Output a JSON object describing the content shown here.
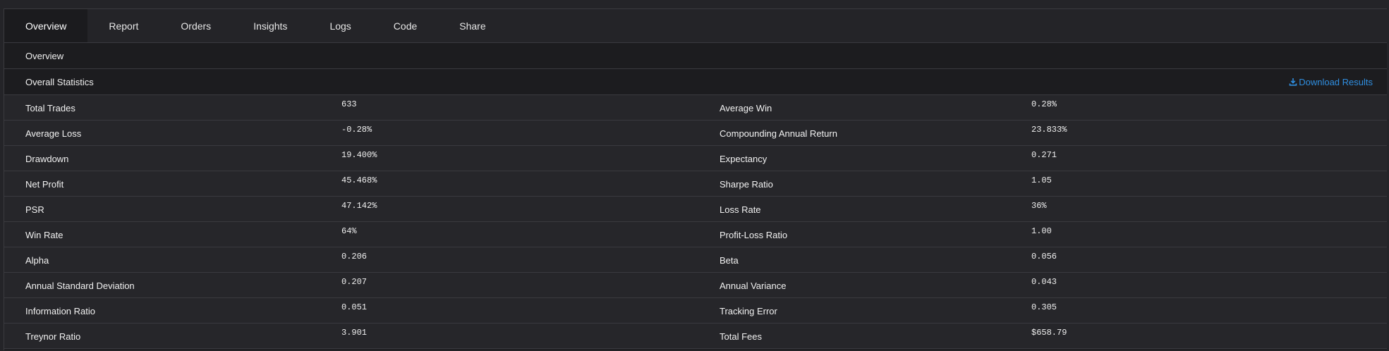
{
  "tabs": [
    {
      "label": "Overview",
      "active": true
    },
    {
      "label": "Report"
    },
    {
      "label": "Orders"
    },
    {
      "label": "Insights"
    },
    {
      "label": "Logs"
    },
    {
      "label": "Code"
    },
    {
      "label": "Share"
    }
  ],
  "overview_bar": {
    "title": "Overview"
  },
  "statistics": {
    "title": "Overall Statistics",
    "download_label": "Download Results",
    "download_icon": "download-icon",
    "accent_color": "#2f8ee0",
    "left": [
      {
        "label": "Total Trades",
        "value": "633"
      },
      {
        "label": "Average Loss",
        "value": "-0.28%"
      },
      {
        "label": "Drawdown",
        "value": "19.400%"
      },
      {
        "label": "Net Profit",
        "value": "45.468%"
      },
      {
        "label": "PSR",
        "value": "47.142%"
      },
      {
        "label": "Win Rate",
        "value": "64%"
      },
      {
        "label": "Alpha",
        "value": "0.206"
      },
      {
        "label": "Annual Standard Deviation",
        "value": "0.207"
      },
      {
        "label": "Information Ratio",
        "value": "0.051"
      },
      {
        "label": "Treynor Ratio",
        "value": "3.901"
      }
    ],
    "right": [
      {
        "label": "Average Win",
        "value": "0.28%"
      },
      {
        "label": "Compounding Annual Return",
        "value": "23.833%"
      },
      {
        "label": "Expectancy",
        "value": "0.271"
      },
      {
        "label": "Sharpe Ratio",
        "value": "1.05"
      },
      {
        "label": "Loss Rate",
        "value": "36%"
      },
      {
        "label": "Profit-Loss Ratio",
        "value": "1.00"
      },
      {
        "label": "Beta",
        "value": "0.056"
      },
      {
        "label": "Annual Variance",
        "value": "0.043"
      },
      {
        "label": "Tracking Error",
        "value": "0.305"
      },
      {
        "label": "Total Fees",
        "value": "$658.79"
      }
    ]
  }
}
